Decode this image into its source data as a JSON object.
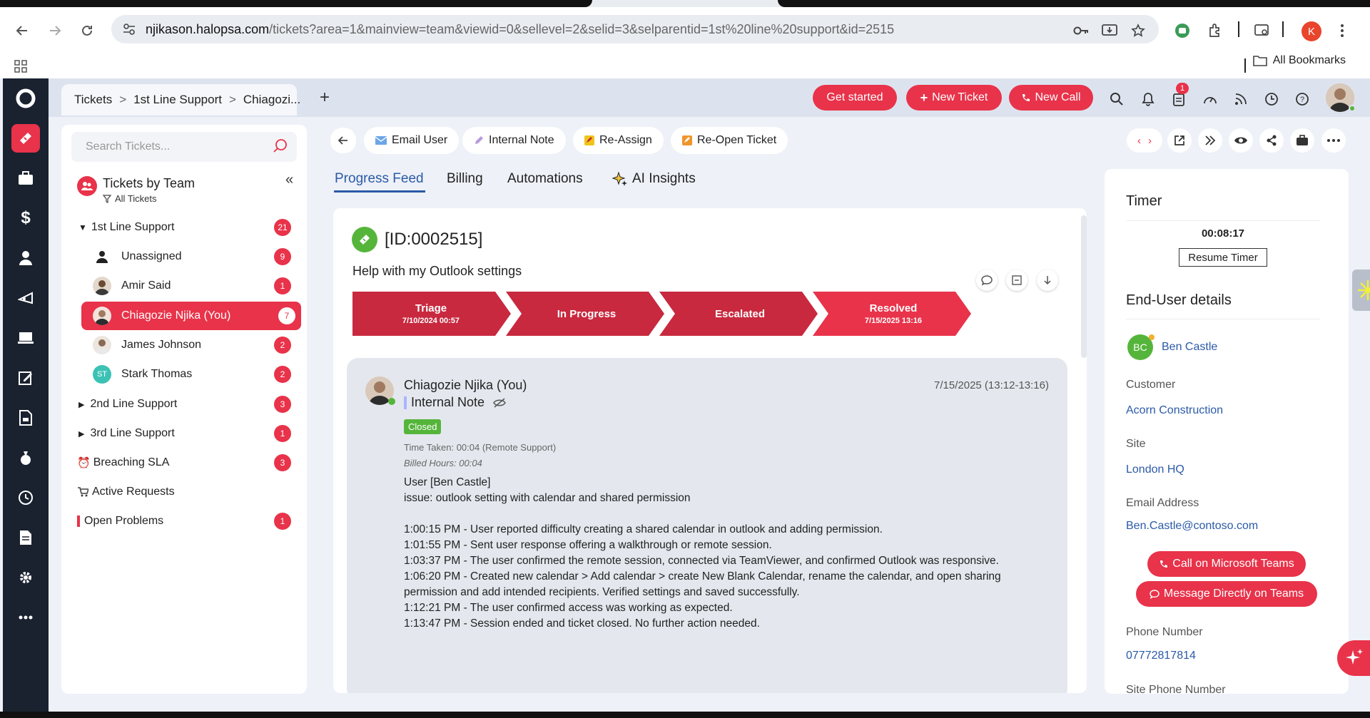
{
  "browser": {
    "url_host": "njikason.halopsa.com",
    "url_path": "/tickets?area=1&mainview=team&viewid=0&sellevel=2&selid=3&selparentid=1st%20line%20support&id=2515",
    "profile_initial": "K",
    "bookmarks_label": "All Bookmarks"
  },
  "header": {
    "breadcrumb": [
      "Tickets",
      "1st Line Support",
      "Chiagozi..."
    ],
    "get_started": "Get started",
    "new_ticket": "New Ticket",
    "new_call": "New Call",
    "notification_count": "1"
  },
  "sidebar": {
    "search_placeholder": "Search Tickets...",
    "title": "Tickets by Team",
    "filter": "All Tickets",
    "items": [
      {
        "label": "1st Line Support",
        "count": "21"
      },
      {
        "label": "Unassigned",
        "count": "9"
      },
      {
        "label": "Amir Said",
        "count": "1"
      },
      {
        "label": "Chiagozie Njika (You)",
        "count": "7"
      },
      {
        "label": "James Johnson",
        "count": "2"
      },
      {
        "label": "Stark Thomas",
        "initials": "ST",
        "count": "2"
      },
      {
        "label": "2nd Line Support",
        "count": "3"
      },
      {
        "label": "3rd Line Support",
        "count": "1"
      },
      {
        "label": "Breaching SLA",
        "count": "3"
      },
      {
        "label": "Active Requests",
        "count": ""
      },
      {
        "label": "Open Problems",
        "count": "1"
      }
    ]
  },
  "toolbar": {
    "email_user": "Email User",
    "internal_note": "Internal Note",
    "reassign": "Re-Assign",
    "reopen": "Re-Open Ticket"
  },
  "tabs": [
    "Progress Feed",
    "Billing",
    "Automations",
    "AI Insights"
  ],
  "ticket": {
    "id": "[ID:0002515]",
    "summary": "Help with my Outlook settings",
    "stages": [
      {
        "name": "Triage",
        "date": "7/10/2024 00:57"
      },
      {
        "name": "In Progress",
        "date": ""
      },
      {
        "name": "Escalated",
        "date": ""
      },
      {
        "name": "Resolved",
        "date": "7/15/2025 13:16"
      }
    ]
  },
  "feed_entry": {
    "author": "Chiagozie Njika (You)",
    "type": "Internal Note",
    "time": "7/15/2025 (13:12-13:16)",
    "status": "Closed",
    "time_taken": "Time Taken: 00:04 (Remote Support)",
    "billed_hours": "Billed Hours: 00:04",
    "body": [
      "User [Ben Castle]",
      "issue: outlook setting with calendar and shared permission",
      "",
      "1:00:15 PM - User reported difficulty creating a shared calendar in outlook and adding permission.",
      "1:01:55 PM - Sent user response offering a walkthrough or remote session.",
      "1:03:37 PM - The user confirmed the remote session, connected via TeamViewer, and confirmed Outlook was responsive.",
      "1:06:20 PM - Created new calendar > Add calendar > create New Blank Calendar, rename the calendar, and open sharing permission and add intended recipients. Verified settings and saved successfully.",
      "1:12:21 PM - The user confirmed access was working as expected.",
      "1:13:47 PM - Session ended and ticket closed. No further action needed."
    ]
  },
  "right_panel": {
    "timer_title": "Timer",
    "timer_value": "00:08:17",
    "resume_timer": "Resume Timer",
    "enduser_title": "End-User details",
    "user_initials": "BC",
    "user_name": "Ben Castle",
    "customer_label": "Customer",
    "customer": "Acorn Construction",
    "site_label": "Site",
    "site": "London HQ",
    "email_label": "Email Address",
    "email": "Ben.Castle@contoso.com",
    "call_teams": "Call on Microsoft Teams",
    "message_teams": "Message Directly on Teams",
    "phone_label": "Phone Number",
    "phone": "07772817814",
    "site_phone_label": "Site Phone Number"
  },
  "colors": {
    "accent": "#e8334a",
    "link": "#2b5aa8",
    "rail": "#1a2230",
    "success": "#55b53b"
  }
}
